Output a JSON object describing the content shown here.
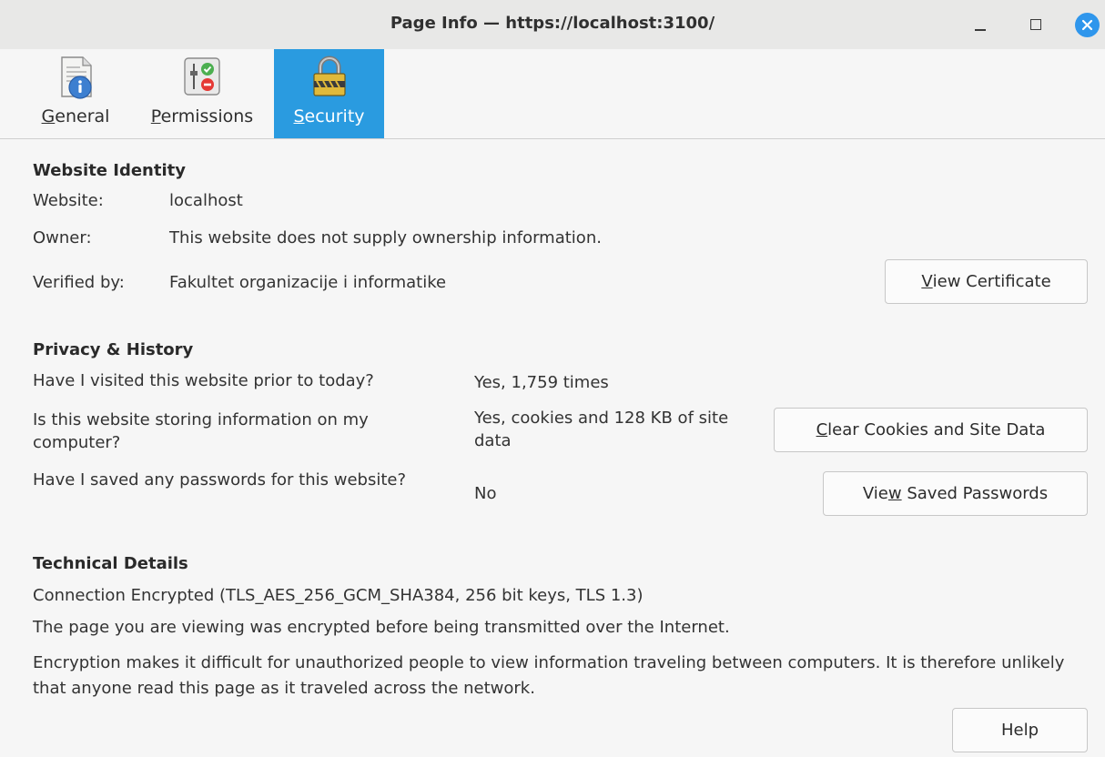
{
  "window": {
    "title": "Page Info — https://localhost:3100/",
    "controls": {
      "minimize": "minimize",
      "maximize": "maximize",
      "close": "close"
    }
  },
  "tabs": [
    {
      "id": "general",
      "label": "General",
      "mnemonic": "G",
      "rest": "eneral",
      "icon": "page-info-icon"
    },
    {
      "id": "permissions",
      "label": "Permissions",
      "mnemonic": "P",
      "rest": "ermissions",
      "icon": "permissions-icon"
    },
    {
      "id": "security",
      "label": "Security",
      "mnemonic": "S",
      "rest": "ecurity",
      "icon": "padlock-icon",
      "selected": true
    }
  ],
  "identity": {
    "heading": "Website Identity",
    "website_label": "Website:",
    "website_value": "localhost",
    "owner_label": "Owner:",
    "owner_value": "This website does not supply ownership information.",
    "verified_label": "Verified by:",
    "verified_value": "Fakultet organizacije i informatike",
    "view_cert_button": {
      "mnemonic": "V",
      "rest": "iew Certificate"
    }
  },
  "privacy": {
    "heading": "Privacy & History",
    "visited_q": "Have I visited this website prior to today?",
    "visited_a": "Yes, 1,759 times",
    "storing_q": "Is this website storing information on my computer?",
    "storing_a": "Yes, cookies and 128 KB of site data",
    "clear_button": {
      "mnemonic": "C",
      "rest": "lear Cookies and Site Data"
    },
    "passwords_q": "Have I saved any passwords for this website?",
    "passwords_a": "No",
    "passwords_button": {
      "pre": "Vie",
      "mnemonic": "w",
      "rest": " Saved Passwords"
    }
  },
  "technical": {
    "heading": "Technical Details",
    "line1": "Connection Encrypted (TLS_AES_256_GCM_SHA384, 256 bit keys, TLS 1.3)",
    "line2": "The page you are viewing was encrypted before being transmitted over the Internet.",
    "line3": "Encryption makes it difficult for unauthorized people to view information traveling between computers. It is therefore unlikely that anyone read this page as it traveled across the network."
  },
  "footer": {
    "help_button": "Help"
  },
  "colors": {
    "accent": "#2a9be0",
    "close_button": "#2f96ec",
    "titlebar": "#e8e8e7",
    "background": "#f6f6f6"
  }
}
